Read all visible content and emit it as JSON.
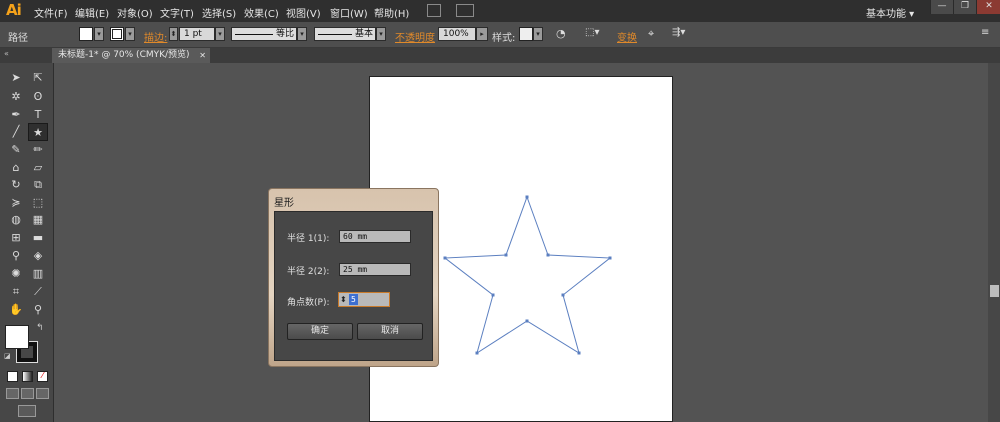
{
  "app": {
    "logo": "Ai"
  },
  "menubar": {
    "items": [
      "文件(F)",
      "编辑(E)",
      "对象(O)",
      "文字(T)",
      "选择(S)",
      "效果(C)",
      "视图(V)",
      "窗口(W)",
      "帮助(H)"
    ],
    "workspace": "基本功能 ▾",
    "window_buttons": [
      "—",
      "❐",
      "✕"
    ]
  },
  "controlbar": {
    "selection_label": "路径",
    "stroke_label": "描边:",
    "stroke_weight": "1 pt",
    "profile_label": "等比",
    "brush_label": "基本",
    "opacity_label": "不透明度",
    "opacity_value": "100%",
    "style_label": "样式:",
    "transform_label": "变换"
  },
  "document": {
    "tab_title": "未标题-1* @ 70% (CMYK/预览)",
    "close": "✕"
  },
  "dialog": {
    "title": "星形",
    "radius1_label": "半径 1(1):",
    "radius1_value": "60 mm",
    "radius2_label": "半径 2(2):",
    "radius2_value": "25 mm",
    "points_label": "角点数(P):",
    "points_value": "5",
    "ok_label": "确定",
    "cancel_label": "取消"
  },
  "colors": {
    "stroke": "#5b7fc0",
    "accent": "#e0892a",
    "dialog_frame": "#d7c3ad"
  }
}
